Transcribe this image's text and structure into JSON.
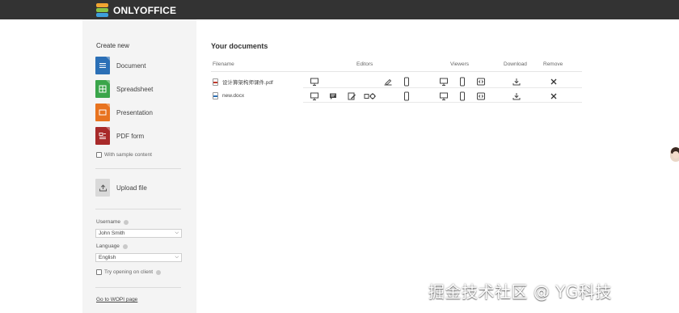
{
  "header": {
    "brand": "ONLYOFFICE"
  },
  "sidebar": {
    "create_title": "Create new",
    "create_items": [
      {
        "label": "Document",
        "color": "#2b6fb6",
        "icon": "document-icon"
      },
      {
        "label": "Spreadsheet",
        "color": "#3aa54a",
        "icon": "spreadsheet-icon"
      },
      {
        "label": "Presentation",
        "color": "#e8731f",
        "icon": "presentation-icon"
      },
      {
        "label": "PDF form",
        "color": "#a82a2a",
        "icon": "pdf-form-icon"
      }
    ],
    "sample_content_label": "With sample content",
    "upload_label": "Upload file",
    "username_label": "Username",
    "username_value": "John Smith",
    "language_label": "Language",
    "language_value": "English",
    "try_client_label": "Try opening on client",
    "wopi_link": "Go to WOPI page"
  },
  "main": {
    "title": "Your documents",
    "columns": {
      "filename": "Filename",
      "editors": "Editors",
      "viewers": "Viewers",
      "download": "Download",
      "remove": "Remove"
    },
    "files": [
      {
        "name": "设计算架构师课件.pdf",
        "type": "pdf",
        "color": "#c0392b"
      },
      {
        "name": "new.docx",
        "type": "docx",
        "color": "#2b6fb6"
      }
    ]
  },
  "watermark": "掘金技术社区 @ YG科技"
}
